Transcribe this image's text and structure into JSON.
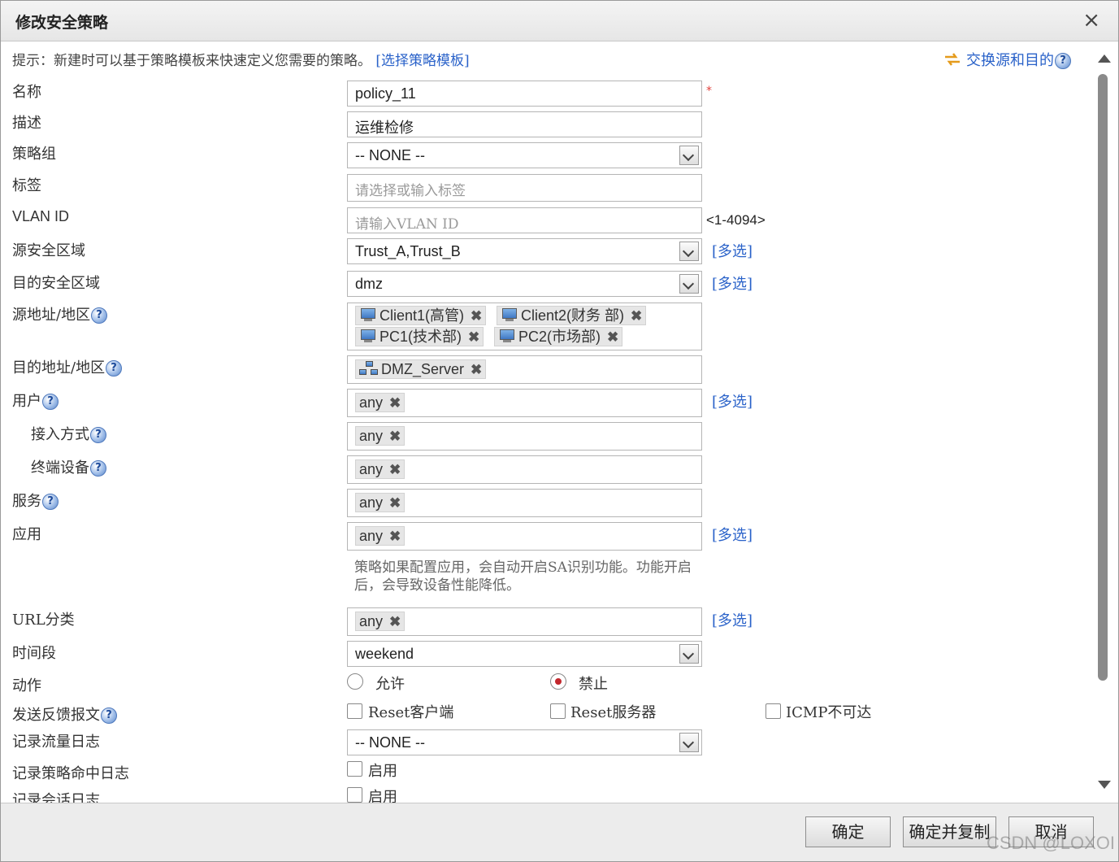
{
  "dialog": {
    "title": "修改安全策略",
    "close": "×"
  },
  "hint": {
    "text": "提示：新建时可以基于策略模板来快速定义您需要的策略。",
    "link": "[选择策略模板]"
  },
  "swap_label": "交换源和目的",
  "fields": {
    "name": {
      "label": "名称",
      "value": "policy_11",
      "required": "*"
    },
    "desc": {
      "label": "描述",
      "value": "运维检修"
    },
    "group": {
      "label": "策略组",
      "value": "-- NONE --"
    },
    "tag": {
      "label": "标签",
      "placeholder": "请选择或输入标签"
    },
    "vlan": {
      "label": "VLAN ID",
      "placeholder": "请输入VLAN ID",
      "range": "<1-4094>"
    },
    "src_zone": {
      "label": "源安全区域",
      "value": "Trust_A,Trust_B",
      "multi": "[多选]"
    },
    "dst_zone": {
      "label": "目的安全区域",
      "value": "dmz",
      "multi": "[多选]"
    },
    "src_addr": {
      "label": "源地址/地区",
      "tags": [
        "Client1(高管)",
        "Client2(财务 部)",
        "PC1(技术部)",
        "PC2(市场部)"
      ]
    },
    "dst_addr": {
      "label": "目的地址/地区",
      "tags": [
        "DMZ_Server"
      ]
    },
    "user": {
      "label": "用户",
      "tag": "any",
      "multi": "[多选]"
    },
    "access": {
      "label": "接入方式",
      "tag": "any"
    },
    "device": {
      "label": "终端设备",
      "tag": "any"
    },
    "service": {
      "label": "服务",
      "tag": "any"
    },
    "app": {
      "label": "应用",
      "tag": "any",
      "multi": "[多选]",
      "note": "策略如果配置应用，会自动开启SA识别功能。功能开启后，会导致设备性能降低。"
    },
    "url": {
      "label": "URL分类",
      "tag": "any",
      "multi": "[多选]"
    },
    "time": {
      "label": "时间段",
      "value": "weekend"
    },
    "action": {
      "label": "动作",
      "allow": "允许",
      "deny": "禁止",
      "selected": "deny"
    },
    "feedback": {
      "label": "发送反馈报文",
      "opt1": "Reset客户端",
      "opt2": "Reset服务器",
      "opt3": "ICMP不可达"
    },
    "traffic_log": {
      "label": "记录流量日志",
      "value": "-- NONE --"
    },
    "hit_log": {
      "label": "记录策略命中日志",
      "opt": "启用"
    },
    "session_log": {
      "label": "记录会话日志",
      "opt": "启用"
    }
  },
  "help_glyph": "?",
  "remove_glyph": "✖",
  "buttons": {
    "ok": "确定",
    "ok_copy": "确定并复制",
    "cancel": "取消"
  },
  "watermark": "CSDN @LOXOI",
  "icons": {
    "close": "close-icon",
    "swap": "swap-arrows-icon",
    "help": "help-icon",
    "pc": "computer-icon",
    "network": "network-icon"
  }
}
